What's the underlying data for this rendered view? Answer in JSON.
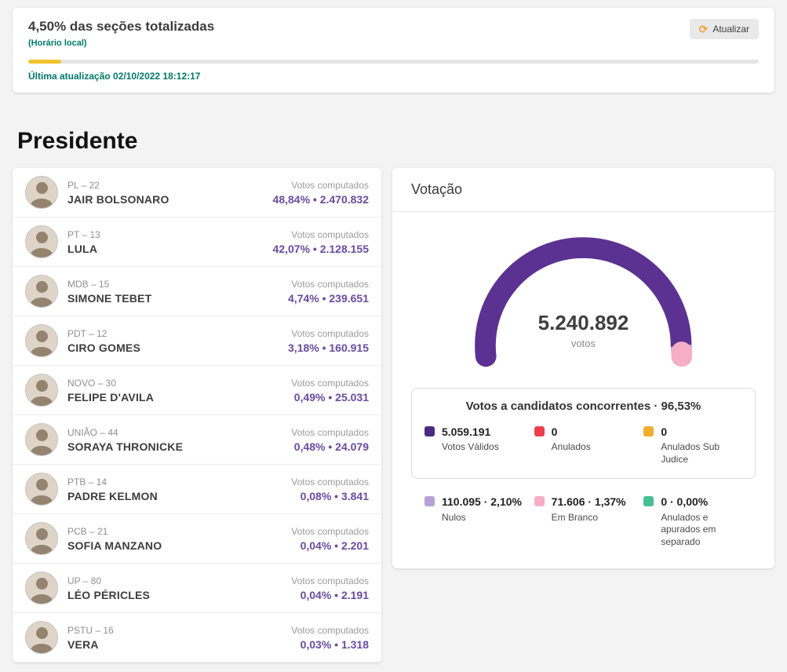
{
  "header": {
    "title": "4,50% das seções totalizadas",
    "subtitle": "(Horário local)",
    "refresh_label": "Atualizar",
    "progress_percent": 4.5,
    "progress_color": "#f2c12e",
    "accent_teal": "#00796b",
    "last_update": "Última atualização 02/10/2022 18:12:17"
  },
  "page_title": "Presidente",
  "candidates": [
    {
      "party": "PL – 22",
      "name": "JAIR BOLSONARO",
      "votes_label": "Votos computados",
      "value": "48,84% • 2.470.832"
    },
    {
      "party": "PT – 13",
      "name": "LULA",
      "votes_label": "Votos computados",
      "value": "42,07% • 2.128.155"
    },
    {
      "party": "MDB – 15",
      "name": "SIMONE TEBET",
      "votes_label": "Votos computados",
      "value": "4,74% • 239.651"
    },
    {
      "party": "PDT – 12",
      "name": "CIRO GOMES",
      "votes_label": "Votos computados",
      "value": "3,18% • 160.915"
    },
    {
      "party": "NOVO – 30",
      "name": "FELIPE D'AVILA",
      "votes_label": "Votos computados",
      "value": "0,49% • 25.031"
    },
    {
      "party": "UNIÃO – 44",
      "name": "SORAYA THRONICKE",
      "votes_label": "Votos computados",
      "value": "0,48% • 24.079"
    },
    {
      "party": "PTB – 14",
      "name": "PADRE KELMON",
      "votes_label": "Votos computados",
      "value": "0,08% • 3.841"
    },
    {
      "party": "PCB – 21",
      "name": "SOFIA MANZANO",
      "votes_label": "Votos computados",
      "value": "0,04% • 2.201"
    },
    {
      "party": "UP – 80",
      "name": "LÉO PÉRICLES",
      "votes_label": "Votos computados",
      "value": "0,04% • 2.191"
    },
    {
      "party": "PSTU – 16",
      "name": "VERA",
      "votes_label": "Votos computados",
      "value": "0,03% • 1.318"
    }
  ],
  "votacao": {
    "title": "Votação",
    "total": "5.240.892",
    "total_label": "votos",
    "legend_title": "Votos a candidatos concorrentes · 96,53%",
    "items": [
      {
        "value": "5.059.191",
        "label": "Votos Válidos",
        "color": "#4b2a82"
      },
      {
        "value": "0",
        "label": "Anulados",
        "color": "#ee3f4f"
      },
      {
        "value": "0",
        "label": "Anulados Sub Judice",
        "color": "#efae2f"
      },
      {
        "value": "110.095 · 2,10%",
        "label": "Nulos",
        "color": "#b4a2d6"
      },
      {
        "value": "71.606 · 1,37%",
        "label": "Em Branco",
        "color": "#f6adc6"
      },
      {
        "value": "0 · 0,00%",
        "label": "Anulados e apurados em separado",
        "color": "#45bf94"
      }
    ]
  },
  "chart_data": {
    "type": "gauge",
    "title": "Votação",
    "center_value": "5.240.892",
    "center_label": "votos",
    "segments": [
      {
        "name": "Votos Válidos",
        "percent": 96.53,
        "color": "#5b3191"
      },
      {
        "name": "Nulos",
        "percent": 2.1,
        "color": "#b4a2d6"
      },
      {
        "name": "Em Branco",
        "percent": 1.37,
        "color": "#f6adc6"
      }
    ]
  }
}
